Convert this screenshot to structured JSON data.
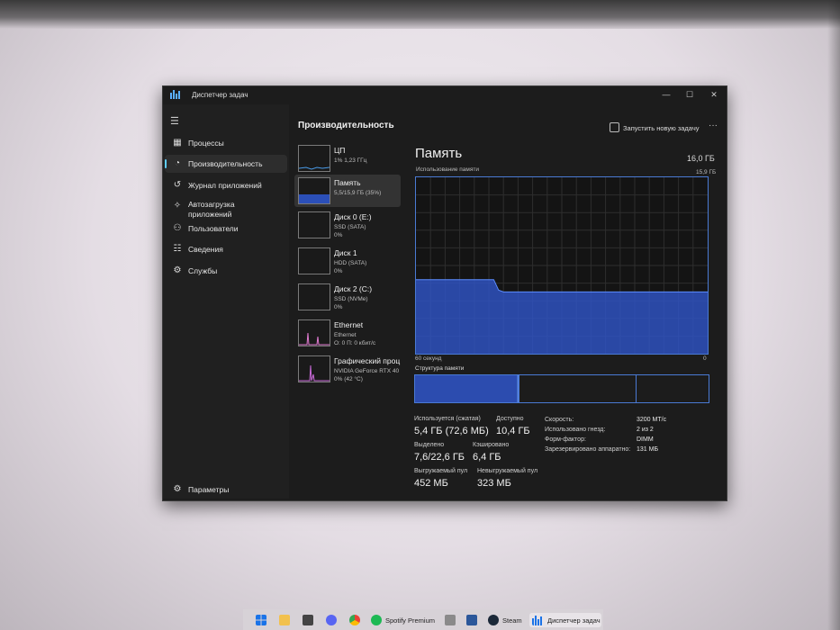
{
  "window": {
    "title": "Диспетчер задач",
    "controls": {
      "minimize": "—",
      "maximize": "☐",
      "close": "✕"
    }
  },
  "nav": {
    "items": [
      {
        "label": "Процессы",
        "icon": "processes-icon"
      },
      {
        "label": "Производительность",
        "icon": "performance-icon",
        "active": true
      },
      {
        "label": "Журнал приложений",
        "icon": "history-icon"
      },
      {
        "label": "Автозагрузка\nприложений",
        "icon": "startup-icon"
      },
      {
        "label": "Пользователи",
        "icon": "users-icon"
      },
      {
        "label": "Сведения",
        "icon": "details-icon"
      },
      {
        "label": "Службы",
        "icon": "services-icon"
      }
    ],
    "settings_label": "Параметры"
  },
  "header": {
    "title": "Производительность",
    "new_task_label": "Запустить новую задачу",
    "more": "···"
  },
  "devices": [
    {
      "name": "ЦП",
      "sub1": "1% 1,23 ГГц",
      "sub2": ""
    },
    {
      "name": "Память",
      "sub1": "5,5/15,9 ГБ (35%)",
      "sub2": "",
      "selected": true
    },
    {
      "name": "Диск 0 (E:)",
      "sub1": "SSD (SATA)",
      "sub2": "0%"
    },
    {
      "name": "Диск 1",
      "sub1": "HDD (SATA)",
      "sub2": "0%"
    },
    {
      "name": "Диск 2 (C:)",
      "sub1": "SSD (NVMe)",
      "sub2": "0%"
    },
    {
      "name": "Ethernet",
      "sub1": "Ethernet",
      "sub2": "О: 0 П: 0 кбит/с"
    },
    {
      "name": "Графический проц",
      "sub1": "NVIDIA GeForce RTX 40",
      "sub2": "0% (42 °C)"
    }
  ],
  "memory": {
    "title": "Память",
    "total": "16,0 ГБ",
    "usage_label": "Использование памяти",
    "usage_max": "15,9 ГБ",
    "axis_left": "60 секунд",
    "axis_right": "0",
    "structure_label": "Структура памяти",
    "usage_history_fraction": [
      0.42,
      0.42,
      0.42,
      0.42,
      0.42,
      0.42,
      0.42,
      0.42,
      0.42,
      0.42,
      0.42,
      0.42,
      0.42,
      0.42,
      0.42,
      0.42,
      0.42,
      0.36,
      0.35,
      0.35,
      0.35,
      0.35,
      0.35,
      0.35,
      0.35,
      0.35,
      0.35,
      0.35,
      0.35,
      0.35,
      0.35,
      0.35,
      0.35,
      0.35,
      0.35,
      0.35,
      0.35,
      0.35,
      0.35,
      0.35,
      0.35,
      0.35,
      0.35,
      0.35,
      0.35,
      0.35,
      0.35,
      0.35,
      0.35,
      0.35,
      0.35,
      0.35,
      0.35,
      0.35,
      0.35,
      0.35,
      0.35,
      0.35,
      0.35,
      0.35,
      0.35
    ],
    "structure_fractions": {
      "in_use": 0.35,
      "modified": 0.005,
      "standby": 0.4,
      "free": 0.25
    },
    "stats": {
      "in_use_label": "Используется (сжатая)",
      "in_use_value": "5,4 ГБ (72,6 МБ)",
      "available_label": "Доступно",
      "available_value": "10,4 ГБ",
      "committed_label": "Выделено",
      "committed_value": "7,6/22,6 ГБ",
      "cached_label": "Кэшировано",
      "cached_value": "6,4 ГБ",
      "paged_label": "Выгружаемый пул",
      "paged_value": "452 МБ",
      "nonpaged_label": "Невыгружаемый пул",
      "nonpaged_value": "323 МБ"
    },
    "details": [
      {
        "k": "Скорость:",
        "v": "3200 МТ/с"
      },
      {
        "k": "Использовано гнезд:",
        "v": "2 из 2"
      },
      {
        "k": "Форм-фактор:",
        "v": "DIMM"
      },
      {
        "k": "Зарезервировано аппаратно:",
        "v": "131 МБ"
      }
    ],
    "accent": "#2f55c9"
  },
  "taskbar": {
    "items": [
      {
        "name": "windows-start-icon",
        "label": ""
      },
      {
        "name": "file-explorer-icon",
        "label": ""
      },
      {
        "name": "app-icon",
        "label": ""
      },
      {
        "name": "discord-icon",
        "label": ""
      },
      {
        "name": "chrome-icon",
        "label": ""
      },
      {
        "name": "spotify-icon",
        "label": "Spotify Premium"
      },
      {
        "name": "app-icon-2",
        "label": ""
      },
      {
        "name": "word-icon",
        "label": ""
      },
      {
        "name": "steam-icon",
        "label": "Steam"
      },
      {
        "name": "task-manager-icon",
        "label": "Диспетчер задач"
      }
    ]
  }
}
